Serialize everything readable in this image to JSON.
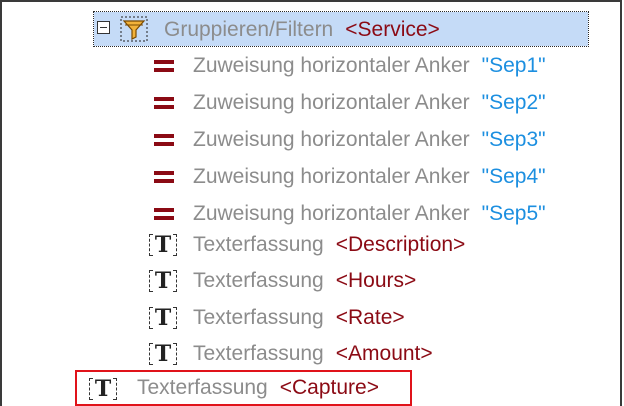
{
  "group": {
    "label": "Gruppieren/Filtern",
    "target": "<Service>"
  },
  "anchors": [
    {
      "label": "Zuweisung horizontaler Anker",
      "value": "\"Sep1\""
    },
    {
      "label": "Zuweisung horizontaler Anker",
      "value": "\"Sep2\""
    },
    {
      "label": "Zuweisung horizontaler Anker",
      "value": "\"Sep3\""
    },
    {
      "label": "Zuweisung horizontaler Anker",
      "value": "\"Sep4\""
    },
    {
      "label": "Zuweisung horizontaler Anker",
      "value": "\"Sep5\""
    }
  ],
  "captures": [
    {
      "label": "Texterfassung",
      "target": "<Description>"
    },
    {
      "label": "Texterfassung",
      "target": "<Hours>"
    },
    {
      "label": "Texterfassung",
      "target": "<Rate>"
    },
    {
      "label": "Texterfassung",
      "target": "<Amount>"
    }
  ],
  "outer_capture": {
    "label": "Texterfassung",
    "target": "<Capture>"
  },
  "icons": {
    "collapse": "collapse-toggle-icon",
    "filter": "filter-icon",
    "assign": "equals-icon",
    "text_capture": "text-capture-icon"
  },
  "colors": {
    "selection": "#c5dbf7",
    "element_red": "#8b0a14",
    "value_blue": "#1c8fe0",
    "highlight_border": "#e0131a"
  }
}
